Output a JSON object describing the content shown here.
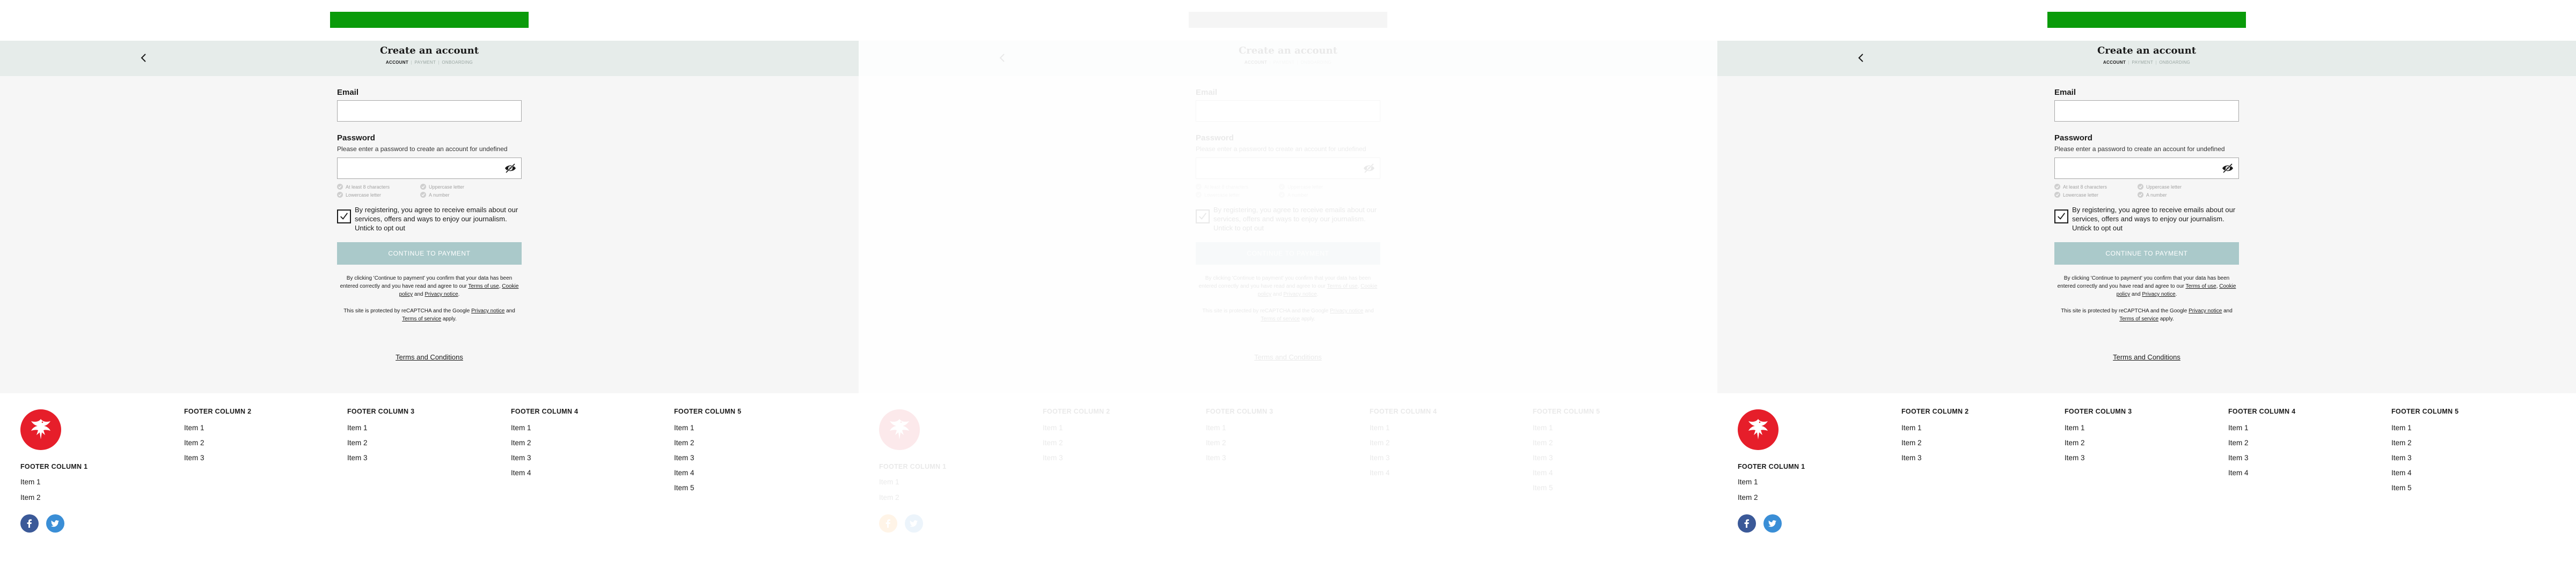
{
  "panels": [
    {
      "state": "active"
    },
    {
      "state": "loading"
    },
    {
      "state": "active"
    }
  ],
  "colors": {
    "brand_bar": "#0a9b0a",
    "header_band": "#e6ecea",
    "form_background": "#f6f6f6",
    "continue_button": "#aac9ca",
    "logo_red": "#e61e2a",
    "facebook": "#3b5998",
    "twitter": "#3a8ed6"
  },
  "header": {
    "title": "Create an account",
    "steps": [
      "ACCOUNT",
      "PAYMENT",
      "ONBOARDING"
    ],
    "active_step": "ACCOUNT",
    "back_icon": "chevron-left-icon"
  },
  "form": {
    "email": {
      "label": "Email",
      "value": "",
      "placeholder": ""
    },
    "password": {
      "label": "Password",
      "hint": "Please enter a password to create an account for undefined",
      "value": "",
      "placeholder": "",
      "toggle_icon": "eye-off-icon",
      "rules": [
        "At least 8 characters",
        "Uppercase letter",
        "Lowercase letter",
        "A number"
      ]
    },
    "consent": {
      "checked": true,
      "text": "By registering, you agree to receive emails about our services, offers and ways to enjoy our journalism. Untick to opt out"
    },
    "continue_label": "CONTINUE TO PAYMENT",
    "legal": {
      "prefix": "By clicking 'Continue to payment' you confirm that your data has been entered correctly and you have read and agree to our",
      "terms_of_use": "Terms of use",
      "sep": ",",
      "cookie_policy": "Cookie policy",
      "and": "and",
      "privacy_notice": "Privacy notice",
      "suffix": "."
    },
    "recaptcha": {
      "prefix": "This site is protected by reCAPTCHA and the Google",
      "privacy_notice": "Privacy notice",
      "and": "and",
      "terms_of_service": "Terms of service",
      "suffix": "apply."
    },
    "terms_link": "Terms and Conditions"
  },
  "footer": {
    "logo_icon": "eagle-logo-icon",
    "columns": [
      {
        "title": "FOOTER COLUMN 1",
        "items": [
          "Item 1",
          "Item 2"
        ]
      },
      {
        "title": "FOOTER COLUMN 2",
        "items": [
          "Item 1",
          "Item 2",
          "Item 3"
        ]
      },
      {
        "title": "FOOTER COLUMN 3",
        "items": [
          "Item 1",
          "Item 2",
          "Item 3"
        ]
      },
      {
        "title": "FOOTER COLUMN 4",
        "items": [
          "Item 1",
          "Item 2",
          "Item 3",
          "Item 4"
        ]
      },
      {
        "title": "FOOTER COLUMN 5",
        "items": [
          "Item 1",
          "Item 2",
          "Item 3",
          "Item 4",
          "Item 5"
        ]
      }
    ],
    "social": [
      "facebook-icon",
      "twitter-icon"
    ]
  }
}
